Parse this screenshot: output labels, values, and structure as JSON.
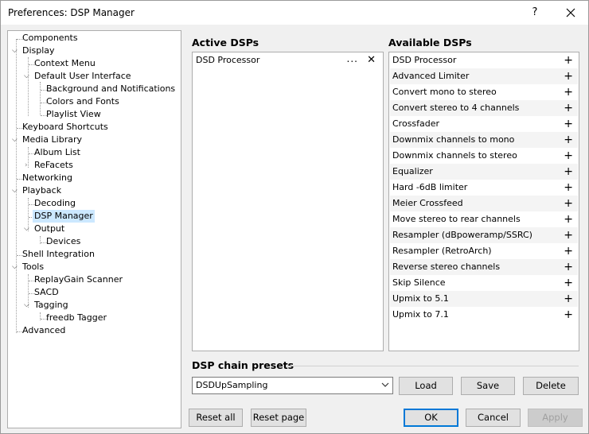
{
  "window": {
    "title": "Preferences: DSP Manager",
    "help_label": "?"
  },
  "tree": [
    {
      "label": "Components"
    },
    {
      "label": "Display"
    },
    {
      "label": "Context Menu"
    },
    {
      "label": "Default User Interface"
    },
    {
      "label": "Background and Notifications"
    },
    {
      "label": "Colors and Fonts"
    },
    {
      "label": "Playlist View"
    },
    {
      "label": "Keyboard Shortcuts"
    },
    {
      "label": "Media Library"
    },
    {
      "label": "Album List"
    },
    {
      "label": "ReFacets"
    },
    {
      "label": "Networking"
    },
    {
      "label": "Playback"
    },
    {
      "label": "Decoding"
    },
    {
      "label": "DSP Manager"
    },
    {
      "label": "Output"
    },
    {
      "label": "Devices"
    },
    {
      "label": "Shell Integration"
    },
    {
      "label": "Tools"
    },
    {
      "label": "ReplayGain Scanner"
    },
    {
      "label": "SACD"
    },
    {
      "label": "Tagging"
    },
    {
      "label": "freedb Tagger"
    },
    {
      "label": "Advanced"
    }
  ],
  "active": {
    "title": "Active DSPs",
    "items": [
      {
        "label": "DSD Processor",
        "more": "...",
        "remove": "✕"
      }
    ]
  },
  "available": {
    "title": "Available DSPs",
    "items": [
      {
        "label": "DSD Processor"
      },
      {
        "label": "Advanced Limiter"
      },
      {
        "label": "Convert mono to stereo"
      },
      {
        "label": "Convert stereo to 4 channels"
      },
      {
        "label": "Crossfader"
      },
      {
        "label": "Downmix channels to mono"
      },
      {
        "label": "Downmix channels to stereo"
      },
      {
        "label": "Equalizer"
      },
      {
        "label": "Hard -6dB limiter"
      },
      {
        "label": "Meier Crossfeed"
      },
      {
        "label": "Move stereo to rear channels"
      },
      {
        "label": "Resampler (dBpoweramp/SSRC)"
      },
      {
        "label": "Resampler (RetroArch)"
      },
      {
        "label": "Reverse stereo channels"
      },
      {
        "label": "Skip Silence"
      },
      {
        "label": "Upmix to 5.1"
      },
      {
        "label": "Upmix to 7.1"
      }
    ],
    "add_symbol": "+"
  },
  "presets": {
    "title": "DSP chain presets",
    "selected": "DSDUpSampling",
    "load_label": "Load",
    "save_label": "Save",
    "delete_label": "Delete"
  },
  "footer": {
    "reset_all_label": "Reset all",
    "reset_page_label": "Reset page",
    "ok_label": "OK",
    "cancel_label": "Cancel",
    "apply_label": "Apply"
  }
}
